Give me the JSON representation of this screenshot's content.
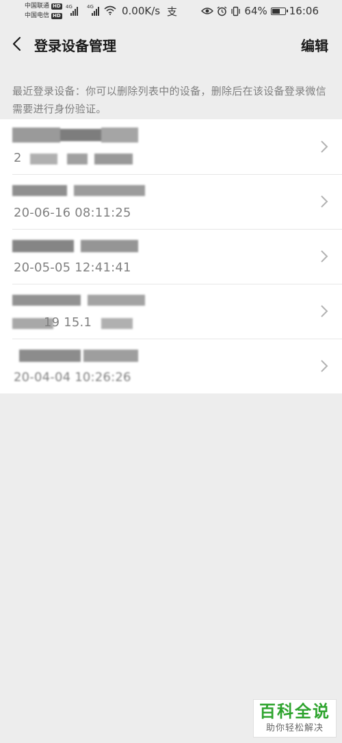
{
  "status_bar": {
    "carrier_1": "中国联通",
    "carrier_2": "中国电信",
    "hd_badge": "HD",
    "network_type": "4G",
    "net_speed": "0.00K/s",
    "pay_icon": "支",
    "battery_percent": "64%",
    "battery_level": 0.64,
    "time": "16:06"
  },
  "nav": {
    "title": "登录设备管理",
    "edit_label": "编辑"
  },
  "notice": "最近登录设备：你可以删除列表中的设备，删除后在该设备登录微信需要进行身份验证。",
  "devices": [
    {
      "time": "2"
    },
    {
      "time": "20-06-16 08:11:25"
    },
    {
      "time": "20-05-05 12:41:41"
    },
    {
      "time": "19 15.1"
    },
    {
      "time": "20-04-04 10:26:26"
    }
  ],
  "watermark": {
    "title": "百科全说",
    "subtitle": "助你轻松解决"
  }
}
